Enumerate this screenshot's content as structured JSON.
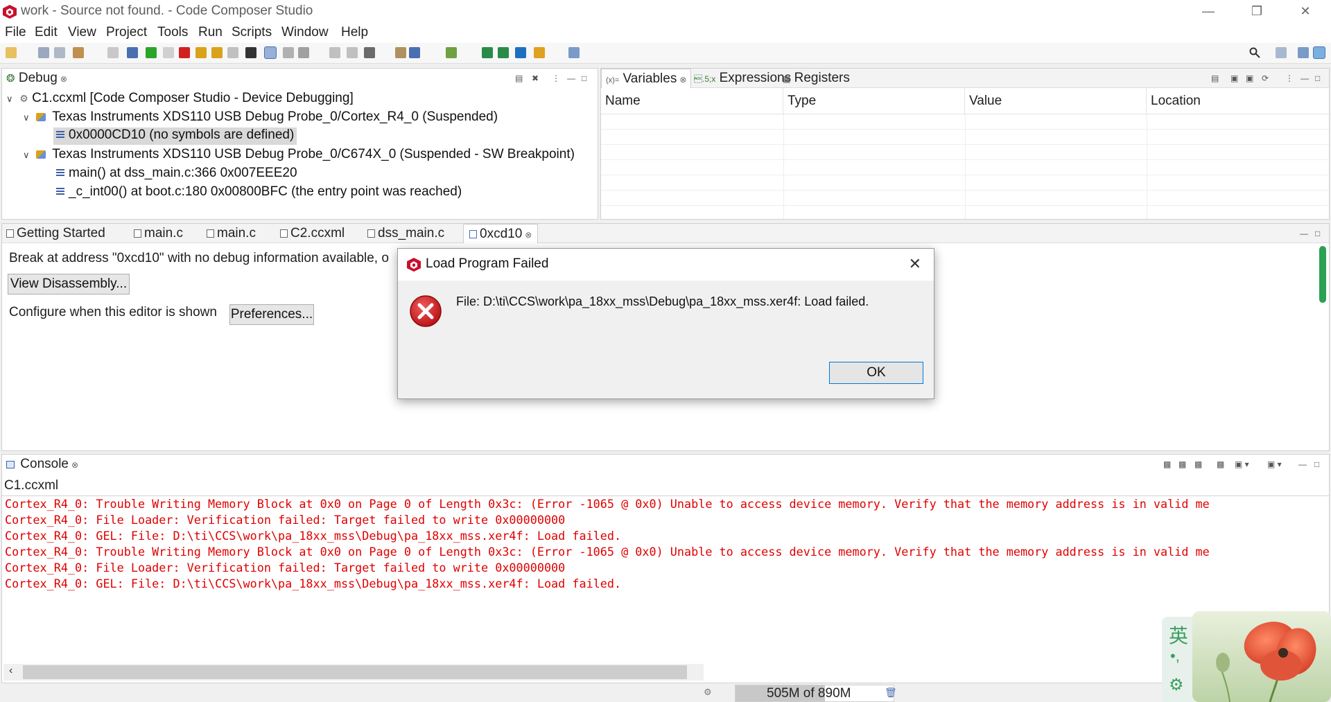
{
  "window": {
    "title": "work - Source not found. - Code Composer Studio",
    "minimize_icon": "minimize-icon",
    "restore_icon": "restore-icon",
    "close_icon": "close-icon"
  },
  "menu": [
    "File",
    "Edit",
    "View",
    "Project",
    "Tools",
    "Run",
    "Scripts",
    "Window",
    "Help"
  ],
  "debug_view": {
    "tab_label": "Debug",
    "tree": [
      {
        "label": "C1.ccxml [Code Composer Studio - Device Debugging]"
      },
      {
        "label": "Texas Instruments XDS110 USB Debug Probe_0/Cortex_R4_0 (Suspended)"
      },
      {
        "label": "0x0000CD10  (no symbols are defined)"
      },
      {
        "label": "Texas Instruments XDS110 USB Debug Probe_0/C674X_0 (Suspended - SW Breakpoint)"
      },
      {
        "label": "main() at dss_main.c:366 0x007EEE20"
      },
      {
        "label": "_c_int00() at boot.c:180 0x00800BFC  (the entry point was reached)"
      }
    ]
  },
  "variables_view": {
    "tabs": [
      "Variables",
      "Expressions",
      "Registers"
    ],
    "columns": [
      "Name",
      "Type",
      "Value",
      "Location"
    ]
  },
  "editor": {
    "tabs": [
      "Getting Started",
      "main.c",
      "main.c",
      "C2.ccxml",
      "dss_main.c",
      "0xcd10"
    ],
    "message": "Break at address \"0xcd10\" with no debug information available, o",
    "view_disassembly_label": "View Disassembly...",
    "configure_label": "Configure when this editor is shown",
    "preferences_label": "Preferences..."
  },
  "dialog": {
    "title": "Load Program Failed",
    "message": "File: D:\\ti\\CCS\\work\\pa_18xx_mss\\Debug\\pa_18xx_mss.xer4f: Load failed.",
    "ok_label": "OK",
    "icon": "error-icon"
  },
  "console": {
    "tab_label": "Console",
    "source": "C1.ccxml",
    "lines": [
      "Cortex_R4_0: Trouble Writing Memory Block at 0x0 on Page 0 of Length 0x3c: (Error -1065 @ 0x0) Unable to access device memory. Verify that the memory address is in valid me",
      "Cortex_R4_0: File Loader: Verification failed: Target failed to write 0x00000000",
      "Cortex_R4_0: GEL: File: D:\\ti\\CCS\\work\\pa_18xx_mss\\Debug\\pa_18xx_mss.xer4f: Load failed.",
      "Cortex_R4_0: Trouble Writing Memory Block at 0x0 on Page 0 of Length 0x3c: (Error -1065 @ 0x0) Unable to access device memory. Verify that the memory address is in valid me",
      "Cortex_R4_0: File Loader: Verification failed: Target failed to write 0x00000000",
      "Cortex_R4_0: GEL: File: D:\\ti\\CCS\\work\\pa_18xx_mss\\Debug\\pa_18xx_mss.xer4f: Load failed."
    ],
    "error_color": "#e00000"
  },
  "status": {
    "memory": "505M of 890M",
    "memory_used_fraction": 0.567
  },
  "ime": {
    "char": "英",
    "punct": "•,"
  }
}
